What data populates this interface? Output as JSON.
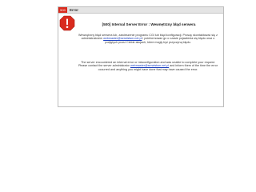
{
  "window": {
    "badge": "500",
    "title": "Error"
  },
  "error": {
    "icon": "error-octagon-icon",
    "heading": "[500] Internal Server Error : Wewnętrzny błąd serwera",
    "polish": {
      "before_link": "Wewnętrzny błąd serwera lub, zawieszenie programu CGI lub błąd konfiguracji. Proszę skontaktować się z administratorem",
      "email": "webmaster@serwistsm.net.pl",
      "after_link": "i poinformować go o czasie pojawienia się błędu oraz o podjętych przez Ciebie akcjach, które mogły być przyczyną błędu."
    },
    "english": {
      "before_link": "The server encountered an internal error or misconfiguration and was unable to complete your request. Please contact the server administrator",
      "email": "webmaster@serwistsm.net.pl",
      "after_link": "and inform them of the time the error occurred and anything you might have done that may have caused the error."
    }
  },
  "colors": {
    "accent": "#d92b1e",
    "link": "#1a3fbf"
  }
}
